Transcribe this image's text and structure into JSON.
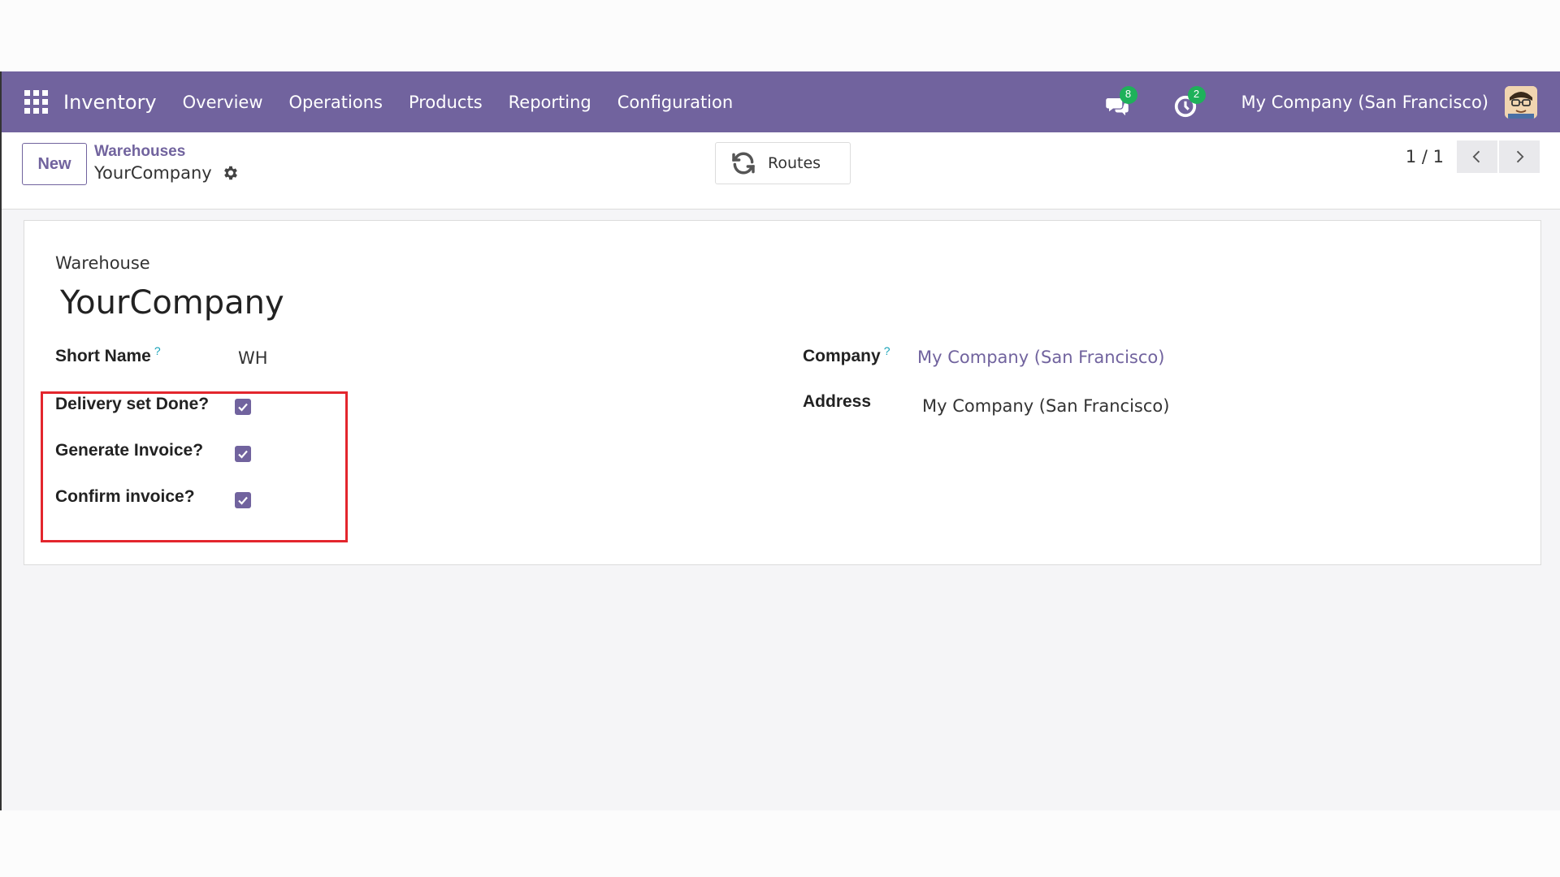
{
  "navbar": {
    "app_name": "Inventory",
    "menu": [
      {
        "label": "Overview"
      },
      {
        "label": "Operations"
      },
      {
        "label": "Products"
      },
      {
        "label": "Reporting"
      },
      {
        "label": "Configuration"
      }
    ],
    "messages_count": "8",
    "activities_count": "2",
    "company": "My Company (San Francisco)"
  },
  "control_panel": {
    "new_label": "New",
    "breadcrumb_parent": "Warehouses",
    "breadcrumb_current": "YourCompany",
    "routes_label": "Routes",
    "pager": "1 / 1"
  },
  "form": {
    "warehouse_label": "Warehouse",
    "title": "YourCompany",
    "short_name_label": "Short Name",
    "short_name_help": "?",
    "short_name_value": "WH",
    "company_label": "Company",
    "company_help": "?",
    "company_value": "My Company (San Francisco)",
    "address_label": "Address",
    "address_value": "My Company (San Francisco)",
    "checkboxes": [
      {
        "label": "Delivery set Done?",
        "checked": true
      },
      {
        "label": "Generate Invoice?",
        "checked": true
      },
      {
        "label": "Confirm invoice?",
        "checked": true
      }
    ]
  },
  "colors": {
    "brand": "#71639e",
    "badge": "#1eb15a",
    "highlight": "#e3262d"
  }
}
